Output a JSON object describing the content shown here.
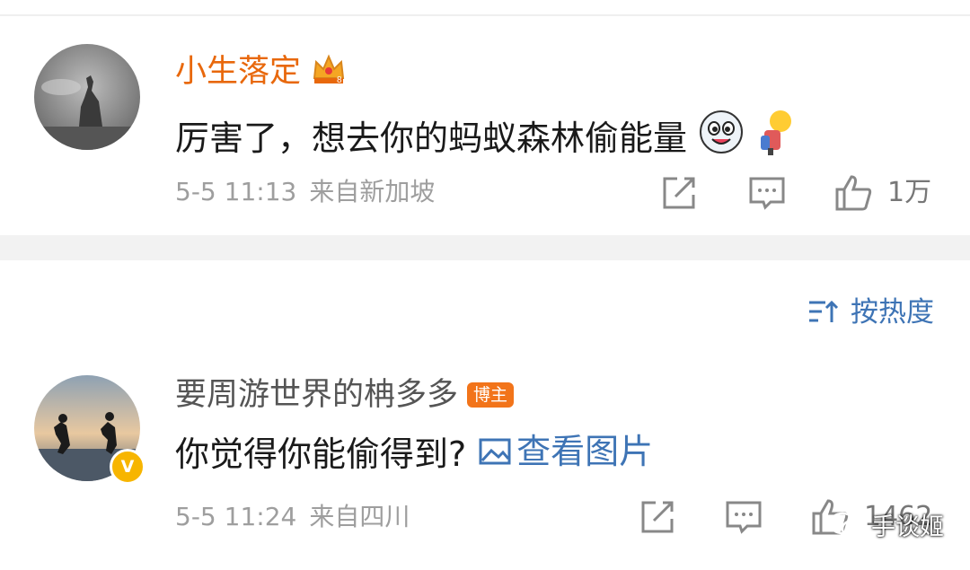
{
  "comments": [
    {
      "username": "小生落定",
      "text": "厉害了，想去你的蚂蚁森林偷能量",
      "time": "5-5 11:13",
      "location": "来自新加坡",
      "like_count": "1万",
      "icons": [
        "crown-badge-icon",
        "dog-emoji-icon",
        "thinking-emoji-icon",
        "share-icon",
        "comment-icon",
        "like-icon"
      ]
    },
    {
      "username": "要周游世界的柟多多",
      "badge": "博主",
      "verified_label": "V",
      "text": "你觉得你能偷得到?",
      "image_link": "查看图片",
      "time": "5-5 11:24",
      "location": "来自四川",
      "like_count": "1462",
      "icons": [
        "image-icon",
        "share-icon",
        "comment-icon",
        "like-icon"
      ]
    }
  ],
  "sort": {
    "label": "按热度"
  },
  "watermark": {
    "label": "手谈姬"
  },
  "colors": {
    "username": "#e8680c",
    "link": "#3e74b5",
    "badge": "#f2741a",
    "verified": "#f7b500"
  }
}
